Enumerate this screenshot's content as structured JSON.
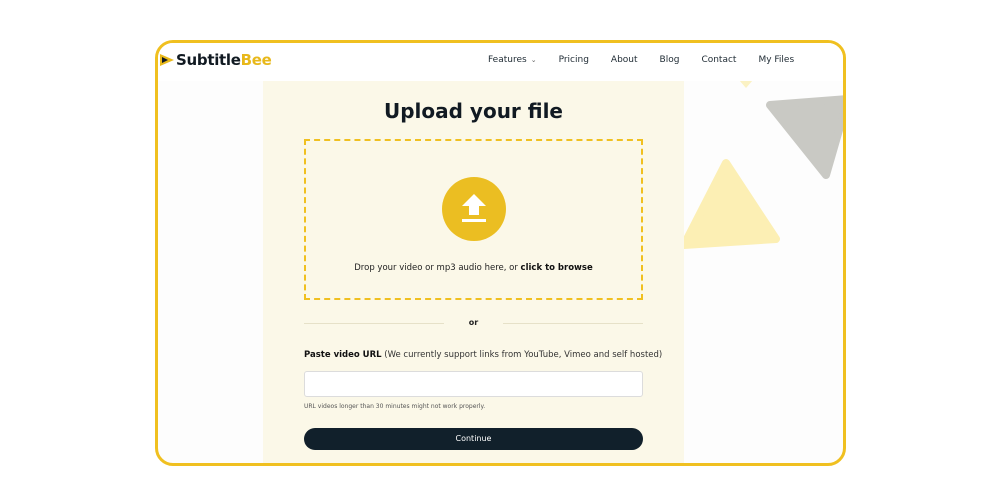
{
  "brand": {
    "name_primary": "Subtitle",
    "name_accent": "Bee"
  },
  "nav": {
    "features": "Features",
    "pricing": "Pricing",
    "about": "About",
    "blog": "Blog",
    "contact": "Contact",
    "my_files": "My Files"
  },
  "upload": {
    "title": "Upload your file",
    "drop_text": "Drop your video or mp3 audio here, or ",
    "browse_link": "click to browse",
    "or": "or",
    "url_label_bold": "Paste video URL",
    "url_label_rest": " (We currently support links from YouTube, Vimeo and self hosted)",
    "url_placeholder": "",
    "url_note": "URL videos longer than 30 minutes might not work properly.",
    "continue": "Continue"
  },
  "colors": {
    "accent": "#f0c020",
    "button_dark": "#11202b",
    "panel_bg": "#fbf8e8"
  },
  "icons": [
    "upload-arrow-icon",
    "chevron-down-icon",
    "logo-icon"
  ]
}
